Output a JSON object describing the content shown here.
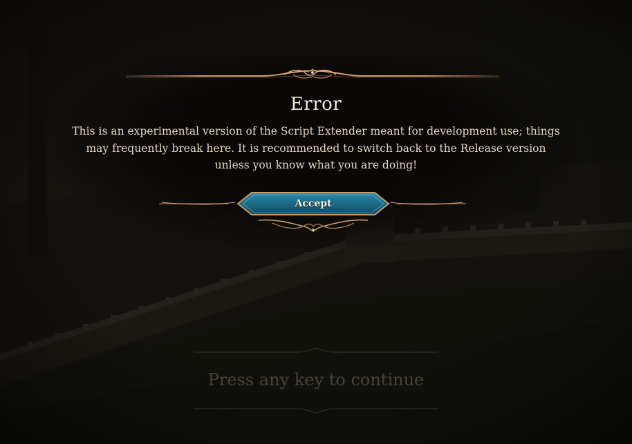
{
  "dialog": {
    "title": "Error",
    "message": "This is an experimental version of the Script Extender meant for development use; things may frequently break here. It is recommended to switch back to the Release version unless you know what you are doing!",
    "accept_label": "Accept"
  },
  "footer": {
    "press_key_text": "Press any key to continue"
  },
  "colors": {
    "accent_gold": "#b8875a",
    "button_teal": "#1f6f8a",
    "title_text": "#f1e9dc"
  },
  "icons": {
    "top_ornament": "gold-filigree-divider",
    "bottom_ornament": "gold-filigree-flourish"
  }
}
